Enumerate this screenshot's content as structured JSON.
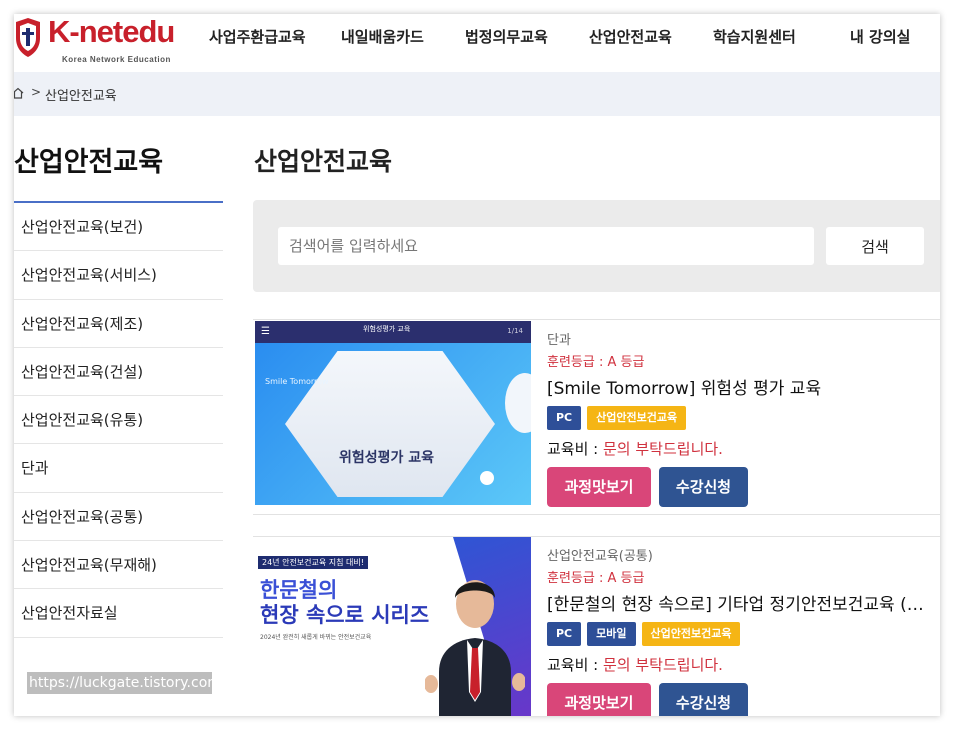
{
  "header": {
    "logo_k": "K",
    "logo_rest": "-netedu",
    "logo_sub": "Korea Network Education",
    "nav": [
      {
        "label": "사업주환급교육"
      },
      {
        "label": "내일배움카드"
      },
      {
        "label": "법정의무교육"
      },
      {
        "label": "산업안전교육"
      },
      {
        "label": "학습지원센터"
      },
      {
        "label": "내 강의실"
      }
    ]
  },
  "breadcrumb": {
    "separator": ">",
    "current": "산업안전교육"
  },
  "sidebar": {
    "title": "산업안전교육",
    "items": [
      {
        "label": "산업안전교육(보건)"
      },
      {
        "label": "산업안전교육(서비스)"
      },
      {
        "label": "산업안전교육(제조)"
      },
      {
        "label": "산업안전교육(건설)"
      },
      {
        "label": "산업안전교육(유통)"
      },
      {
        "label": "단과"
      },
      {
        "label": "산업안전교육(공통)"
      },
      {
        "label": "산업안전교육(무재해)"
      },
      {
        "label": "산업안전자료실"
      }
    ]
  },
  "watermark": "https://luckgate.tistory.com",
  "main": {
    "title": "산업안전교육",
    "search": {
      "placeholder": "검색어를 입력하세요",
      "button": "검색"
    },
    "courses": [
      {
        "category": "단과",
        "grade": "훈련등급 : A 등급",
        "title": "[Smile Tomorrow] 위험성 평가 교육",
        "tags": [
          "PC",
          "산업안전보건교육"
        ],
        "fee_label": "교육비 : ",
        "fee_value": "문의 부탁드립니다.",
        "preview_button": "과정맛보기",
        "apply_button": "수강신청",
        "thumb": {
          "header": "위험성평가 교육",
          "page": "1/14",
          "brand": "Smile Tomorrow",
          "text": "위험성평가 교육"
        }
      },
      {
        "category": "산업안전교육(공통)",
        "grade": "훈련등급 : A 등급",
        "title": "[한문철의 현장 속으로] 기타업 정기안전보건교육 (…",
        "tags": [
          "PC",
          "모바일",
          "산업안전보건교육"
        ],
        "fee_label": "교육비 : ",
        "fee_value": "문의 부탁드립니다.",
        "preview_button": "과정맛보기",
        "apply_button": "수강신청",
        "thumb": {
          "badge": "24년 안전보건교육 지침 대비!",
          "line1": "한문철의",
          "line2": "현장 속으로 시리즈",
          "line3": "2024년 완전히 새롭게 바뀌는 안전보건교육"
        }
      }
    ]
  },
  "colors": {
    "brand_red": "#c8202b",
    "accent_pink": "#d94679",
    "accent_navy": "#2f5492",
    "tag_blue": "#2e4f98",
    "tag_yellow": "#f5b515",
    "sidebar_line": "#4a6fc7"
  }
}
